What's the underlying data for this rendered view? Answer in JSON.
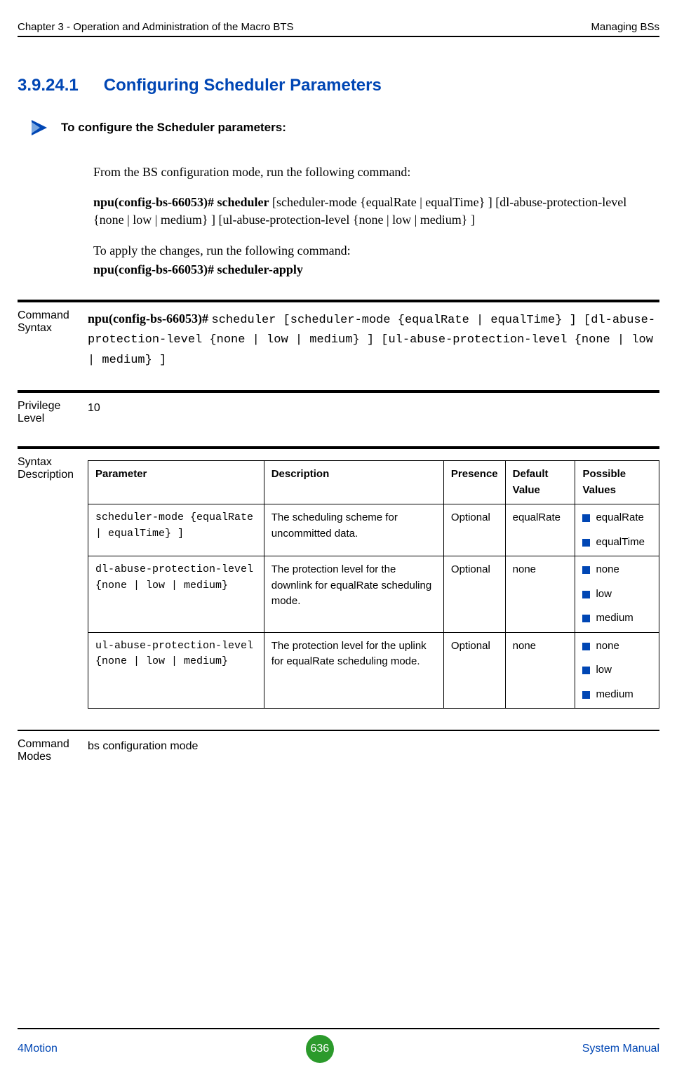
{
  "header": {
    "left": "Chapter 3 - Operation and Administration of the Macro BTS",
    "right": "Managing BSs"
  },
  "section": {
    "number": "3.9.24.1",
    "title": "Configuring Scheduler Parameters"
  },
  "procedure_title": "To configure the Scheduler parameters:",
  "body": {
    "p1": "From the BS configuration mode, run the following command:",
    "p2_bold": "npu(config-bs-66053)# scheduler",
    "p2_rest": " [scheduler-mode {equalRate | equalTime} ] [dl-abuse-protection-level {none | low | medium} ] [ul-abuse-protection-level {none | low | medium} ]",
    "p3": "To apply the changes, run the following command:",
    "p4_bold": "npu(config-bs-66053)# scheduler-apply"
  },
  "defs": {
    "command_syntax_label": "Command Syntax",
    "command_syntax_bold": "npu(config-bs-66053)# ",
    "command_syntax_mono": " scheduler [scheduler-mode {equalRate | equalTime} ] [dl-abuse-protection-level {none | low | medium} ] [ul-abuse-protection-level {none | low | medium} ]",
    "privilege_label": "Privilege Level",
    "privilege_value": "10",
    "syntax_desc_label": "Syntax Description",
    "command_modes_label": "Command Modes",
    "command_modes_value": "bs configuration mode"
  },
  "table": {
    "headers": [
      "Parameter",
      "Description",
      "Presence",
      "Default Value",
      "Possible Values"
    ],
    "rows": [
      {
        "param": "scheduler-mode {equalRate | equalTime} ]",
        "desc": "The scheduling scheme for uncommitted data.",
        "presence": "Optional",
        "default": "equalRate",
        "values": [
          "equalRate",
          "equalTime"
        ]
      },
      {
        "param": "dl-abuse-protection-level {none | low | medium}",
        "desc": "The protection level for the downlink for equalRate scheduling mode.",
        "presence": "Optional",
        "default": "none",
        "values": [
          "none",
          "low",
          "medium"
        ]
      },
      {
        "param": "ul-abuse-protection-level {none | low | medium}",
        "desc": "The protection level for the uplink for equalRate scheduling mode.",
        "presence": "Optional",
        "default": "none",
        "values": [
          "none",
          "low",
          "medium"
        ]
      }
    ]
  },
  "footer": {
    "left": "4Motion",
    "page": "636",
    "right": "System Manual"
  }
}
